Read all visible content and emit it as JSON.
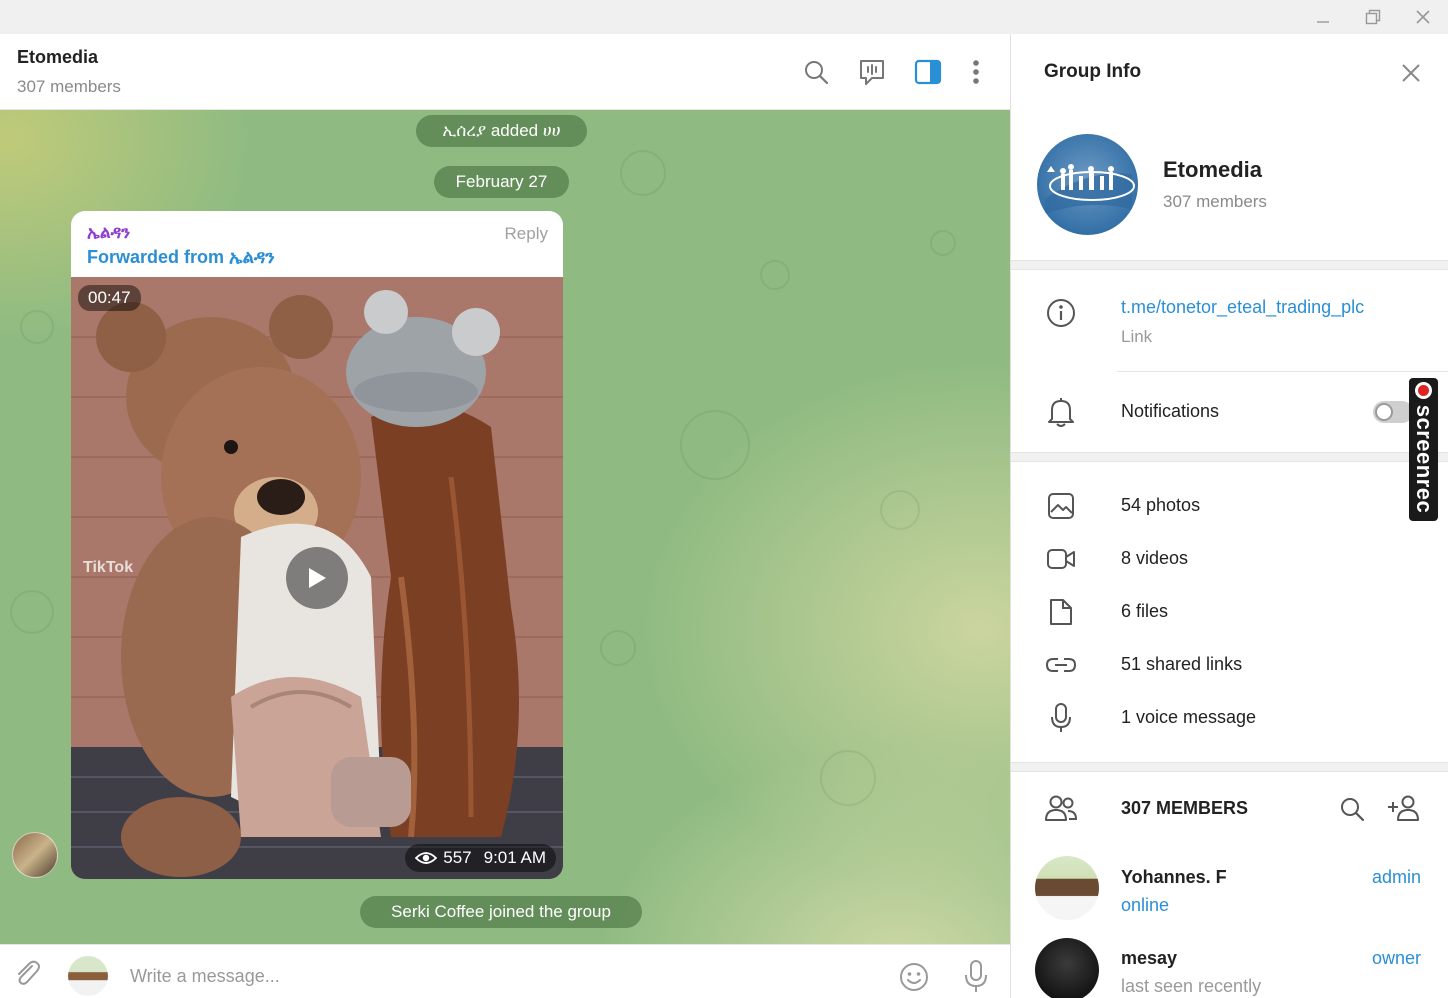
{
  "window": {
    "controls": [
      "minimize-icon",
      "restore-icon",
      "close-icon"
    ]
  },
  "chat": {
    "title": "Etomedia",
    "subtitle": "307 members",
    "header_icons": [
      "search-icon",
      "voice-chat-icon",
      "sidebar-toggle-icon",
      "more-vert-icon"
    ]
  },
  "messages": {
    "service_added": "ኢሰረያ added ሀሀ",
    "date_divider": "February 27",
    "post": {
      "sender": "ኤልዳን",
      "forwarded": "Forwarded from ኤልዳን",
      "reply_label": "Reply",
      "video_duration": "00:47",
      "views": "557",
      "time": "9:01 AM",
      "watermark": "TikTok"
    },
    "service_joined": "Serki Coffee joined the group"
  },
  "composer": {
    "placeholder": "Write a message..."
  },
  "group_info": {
    "title": "Group Info",
    "name": "Etomedia",
    "members_label": "307 members",
    "link": "t.me/tonetor_eteal_trading_plc",
    "link_caption": "Link",
    "notifications_label": "Notifications",
    "notifications_on": false,
    "media": [
      {
        "icon": "photo-icon",
        "label": "54 photos"
      },
      {
        "icon": "video-icon",
        "label": "8 videos"
      },
      {
        "icon": "file-icon",
        "label": "6 files"
      },
      {
        "icon": "link-icon",
        "label": "51 shared links"
      },
      {
        "icon": "microphone-icon",
        "label": "1 voice message"
      }
    ],
    "members_header": "307 MEMBERS",
    "members": [
      {
        "name": "Yohannes. F",
        "status": "online",
        "role": "admin"
      },
      {
        "name": "mesay",
        "status": "last seen recently",
        "role": "owner"
      }
    ]
  },
  "overlay": {
    "recorder_label": "screenrec"
  },
  "colors": {
    "accent": "#2a8fd4",
    "sender_name": "#8e3fd1",
    "service_pill": "#527c4a"
  }
}
